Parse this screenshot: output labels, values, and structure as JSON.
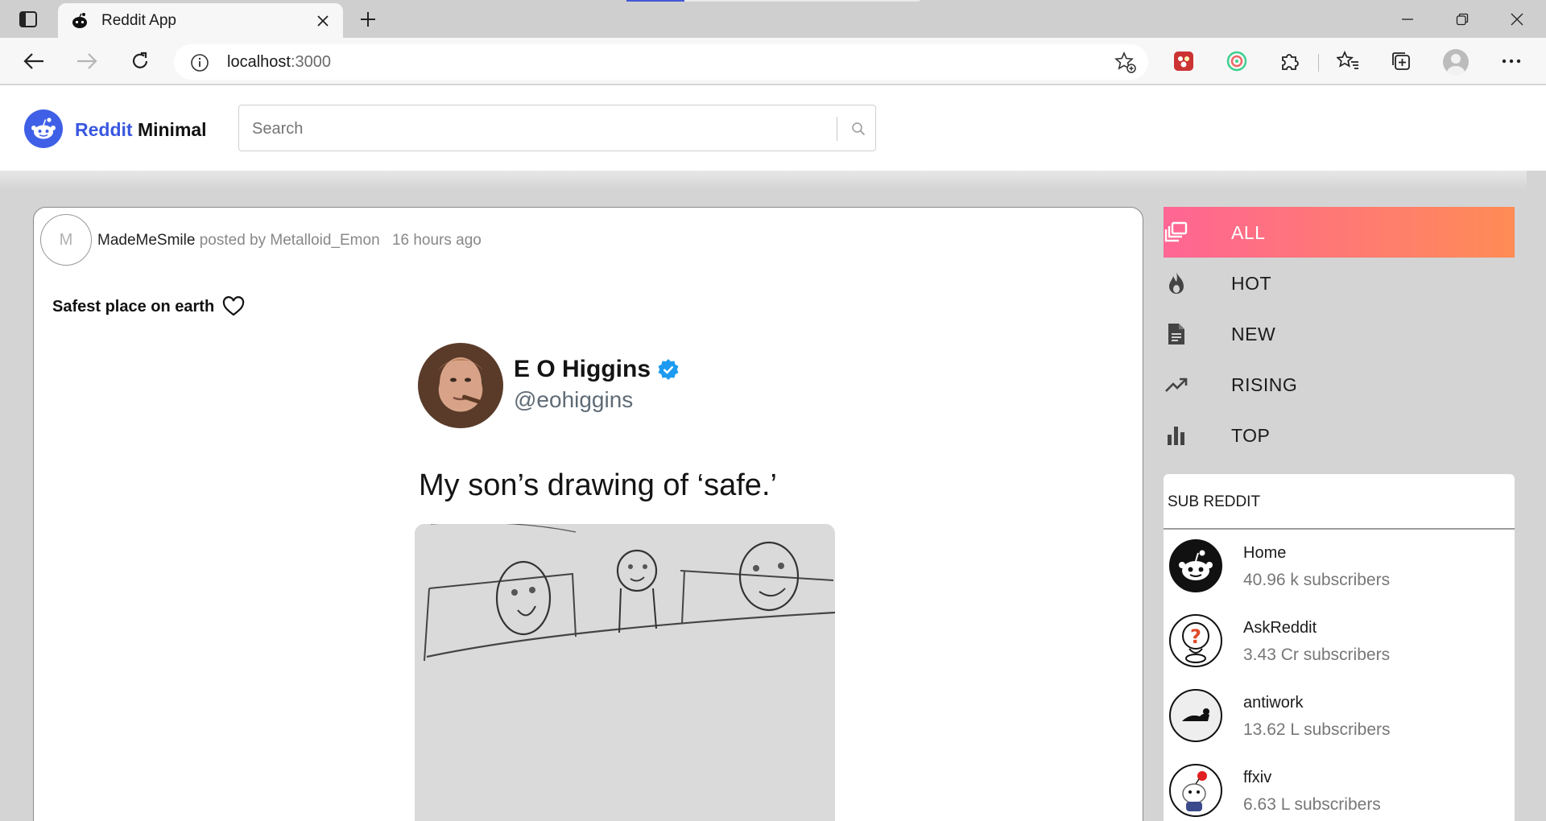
{
  "browser": {
    "tab_title": "Reddit App",
    "url_host": "localhost",
    "url_port": ":3000"
  },
  "header": {
    "brand_accent": "Reddit",
    "brand_rest": "Minimal",
    "search_placeholder": "Search"
  },
  "post": {
    "avatar_letter": "M",
    "subreddit": "MadeMeSmile",
    "posted_by_label": "posted by",
    "author": "Metalloid_Emon",
    "time": "16 hours ago",
    "title": "Safest place on earth",
    "tweet": {
      "name": "E O Higgins",
      "handle": "@eohiggins",
      "text": "My son’s drawing of ‘safe.’"
    }
  },
  "categories": [
    {
      "label": "ALL",
      "icon": "layers-icon",
      "active": true
    },
    {
      "label": "HOT",
      "icon": "flame-icon",
      "active": false
    },
    {
      "label": "NEW",
      "icon": "document-icon",
      "active": false
    },
    {
      "label": "RISING",
      "icon": "trending-up-icon",
      "active": false
    },
    {
      "label": "TOP",
      "icon": "bar-chart-icon",
      "active": false
    }
  ],
  "subreddits": {
    "title": "SUB REDDIT",
    "items": [
      {
        "name": "Home",
        "subscribers": "40.96 k subscribers"
      },
      {
        "name": "AskReddit",
        "subscribers": "3.43 Cr subscribers"
      },
      {
        "name": "antiwork",
        "subscribers": "13.62 L subscribers"
      },
      {
        "name": "ffxiv",
        "subscribers": "6.63 L subscribers"
      }
    ]
  },
  "colors": {
    "brand_blue": "#3957e0",
    "active_gradient_start": "#ff6594",
    "active_gradient_end": "#ff8c55",
    "verified_blue": "#1d9bf0"
  }
}
